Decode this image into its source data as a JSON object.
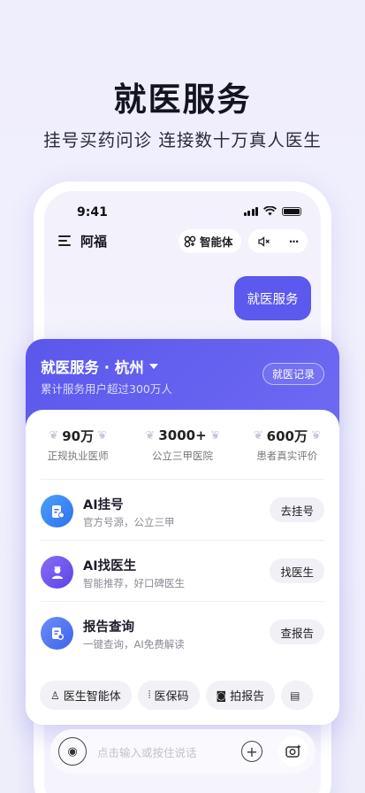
{
  "hero": {
    "title": "就医服务",
    "subtitle": "挂号买药问诊  连接数十万真人医生"
  },
  "status_bar": {
    "time": "9:41"
  },
  "nav": {
    "title": "阿福",
    "agent_label": "智能体",
    "more_label": "···"
  },
  "chat": {
    "user_message": "就医服务"
  },
  "card": {
    "title": "就医服务 · 杭州",
    "subtitle": "累计服务用户超过300万人",
    "record_button": "就医记录",
    "stats": [
      {
        "value": "90万",
        "label": "正规执业医师"
      },
      {
        "value": "3000+",
        "label": "公立三甲医院"
      },
      {
        "value": "600万",
        "label": "患者真实评价"
      }
    ],
    "services": [
      {
        "name": "AI挂号",
        "desc": "官方号源，公立三甲",
        "button": "去挂号",
        "icon": "register-icon",
        "color": "#3d8cf5"
      },
      {
        "name": "AI找医生",
        "desc": "智能推荐，好口碑医生",
        "button": "找医生",
        "icon": "doctor-icon",
        "color": "#6b5cf0"
      },
      {
        "name": "报告查询",
        "desc": "一键查询，AI免费解读",
        "button": "查报告",
        "icon": "report-icon",
        "color": "#4c7df2"
      }
    ],
    "chips": [
      {
        "label": "医生智能体",
        "icon": "doctor-agent-icon"
      },
      {
        "label": "医保码",
        "icon": "scan-code-icon"
      },
      {
        "label": "拍报告",
        "icon": "camera-icon"
      },
      {
        "label": "",
        "icon": "document-icon"
      }
    ]
  },
  "input": {
    "placeholder": "点击输入或按住说话"
  },
  "colors": {
    "accent": "#5b57ec",
    "background": "#efeefd"
  }
}
